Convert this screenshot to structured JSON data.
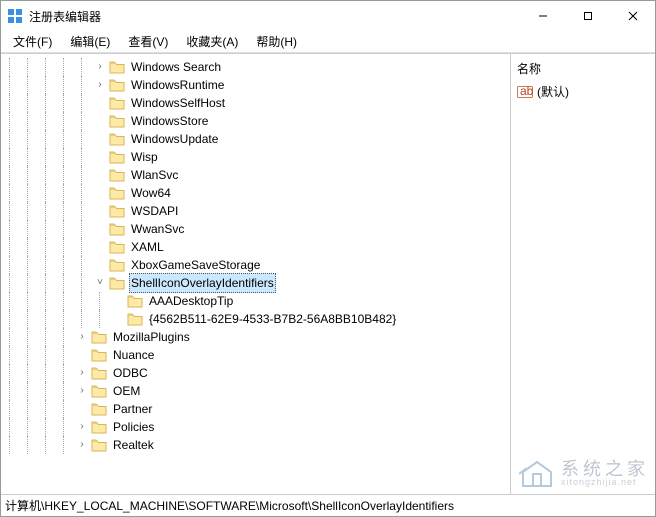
{
  "window": {
    "title": "注册表编辑器"
  },
  "menu": {
    "file": "文件(F)",
    "edit": "编辑(E)",
    "view": "查看(V)",
    "favorites": "收藏夹(A)",
    "help": "帮助(H)"
  },
  "tree": {
    "base_indent_levels": 5,
    "items": [
      {
        "label": "Windows Search",
        "level": 0,
        "expand": "collapsed",
        "selected": false
      },
      {
        "label": "WindowsRuntime",
        "level": 0,
        "expand": "collapsed",
        "selected": false
      },
      {
        "label": "WindowsSelfHost",
        "level": 0,
        "expand": "none",
        "selected": false
      },
      {
        "label": "WindowsStore",
        "level": 0,
        "expand": "none",
        "selected": false
      },
      {
        "label": "WindowsUpdate",
        "level": 0,
        "expand": "none",
        "selected": false
      },
      {
        "label": "Wisp",
        "level": 0,
        "expand": "none",
        "selected": false
      },
      {
        "label": "WlanSvc",
        "level": 0,
        "expand": "none",
        "selected": false
      },
      {
        "label": "Wow64",
        "level": 0,
        "expand": "none",
        "selected": false
      },
      {
        "label": "WSDAPI",
        "level": 0,
        "expand": "none",
        "selected": false
      },
      {
        "label": "WwanSvc",
        "level": 0,
        "expand": "none",
        "selected": false
      },
      {
        "label": "XAML",
        "level": 0,
        "expand": "none",
        "selected": false
      },
      {
        "label": "XboxGameSaveStorage",
        "level": 0,
        "expand": "none",
        "selected": false
      },
      {
        "label": "ShellIconOverlayIdentifiers",
        "level": 0,
        "expand": "expanded",
        "selected": true
      },
      {
        "label": "AAADesktopTip",
        "level": 1,
        "expand": "none",
        "selected": false
      },
      {
        "label": "{4562B511-62E9-4533-B7B2-56A8BB10B482}",
        "level": 1,
        "expand": "none",
        "selected": false
      },
      {
        "label": "MozillaPlugins",
        "level": -1,
        "expand": "collapsed",
        "selected": false
      },
      {
        "label": "Nuance",
        "level": -1,
        "expand": "none",
        "selected": false
      },
      {
        "label": "ODBC",
        "level": -1,
        "expand": "collapsed",
        "selected": false
      },
      {
        "label": "OEM",
        "level": -1,
        "expand": "collapsed",
        "selected": false
      },
      {
        "label": "Partner",
        "level": -1,
        "expand": "none",
        "selected": false
      },
      {
        "label": "Policies",
        "level": -1,
        "expand": "collapsed",
        "selected": false
      },
      {
        "label": "Realtek",
        "level": -1,
        "expand": "collapsed",
        "selected": false
      }
    ]
  },
  "right": {
    "column_name": "名称",
    "default_value": "(默认)"
  },
  "status": {
    "path": "计算机\\HKEY_LOCAL_MACHINE\\SOFTWARE\\Microsoft\\ShellIconOverlayIdentifiers"
  },
  "watermark": {
    "cn": "系统之家",
    "url": "xitongzhijia.net"
  }
}
